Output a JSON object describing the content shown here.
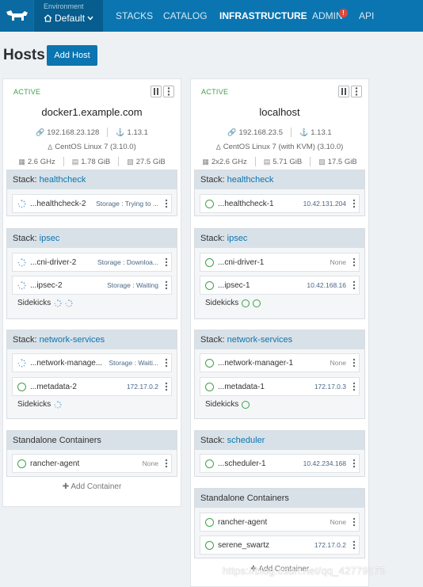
{
  "nav": {
    "environment_caption": "Environment",
    "environment_value": "Default",
    "items": [
      "STACKS",
      "CATALOG",
      "INFRASTRUCTURE",
      "ADMIN",
      "API"
    ],
    "admin_badge": "!"
  },
  "page": {
    "title": "Hosts",
    "add_host": "Add Host"
  },
  "hosts": [
    {
      "state": "ACTIVE",
      "name": "docker1.example.com",
      "ip": "192.168.23.128",
      "docker_version": "1.13.1",
      "os": "CentOS Linux 7 (3.10.0)",
      "cpu": "2.6 GHz",
      "memory": "1.78 GiB",
      "storage": "27.5 GiB",
      "stacks": [
        {
          "label": "Stack:",
          "name": "healthcheck",
          "containers": [
            {
              "name": "...healthcheck-2",
              "ip": "Storage : Trying to ..."
            }
          ]
        },
        {
          "label": "Stack:",
          "name": "ipsec",
          "containers": [
            {
              "name": "...cni-driver-2",
              "ip": "Storage : Downloa..."
            },
            {
              "name": "...ipsec-2",
              "ip": "Storage : Waiting"
            }
          ],
          "sidekicks": "Sidekicks"
        },
        {
          "label": "Stack:",
          "name": "network-services",
          "containers": [
            {
              "name": "...network-manage...",
              "ip": "Storage : Waiti..."
            },
            {
              "name": "...metadata-2",
              "ip": "172.17.0.2"
            }
          ],
          "sidekicks": "Sidekicks"
        },
        {
          "label": "Standalone Containers",
          "name": "",
          "containers": [
            {
              "name": "rancher-agent",
              "ip": "None"
            }
          ]
        }
      ],
      "add_container": "Add Container"
    },
    {
      "state": "ACTIVE",
      "name": "localhost",
      "ip": "192.168.23.5",
      "docker_version": "1.13.1",
      "os": "CentOS Linux 7 (with KVM) (3.10.0)",
      "cpu": "2x2.6 GHz",
      "memory": "5.71 GiB",
      "storage": "17.5 GiB",
      "stacks": [
        {
          "label": "Stack:",
          "name": "healthcheck",
          "containers": [
            {
              "name": "...healthcheck-1",
              "ip": "10.42.131.204"
            }
          ]
        },
        {
          "label": "Stack:",
          "name": "ipsec",
          "containers": [
            {
              "name": "...cni-driver-1",
              "ip": "None"
            },
            {
              "name": "...ipsec-1",
              "ip": "10.42.168.16"
            }
          ],
          "sidekicks": "Sidekicks"
        },
        {
          "label": "Stack:",
          "name": "network-services",
          "containers": [
            {
              "name": "...network-manager-1",
              "ip": "None"
            },
            {
              "name": "...metadata-1",
              "ip": "172.17.0.3"
            }
          ],
          "sidekicks": "Sidekicks"
        },
        {
          "label": "Stack:",
          "name": "scheduler",
          "containers": [
            {
              "name": "...scheduler-1",
              "ip": "10.42.234.168"
            }
          ]
        },
        {
          "label": "Standalone Containers",
          "name": "",
          "containers": [
            {
              "name": "rancher-agent",
              "ip": "None"
            },
            {
              "name": "serene_swartz",
              "ip": "172.17.0.2"
            }
          ]
        }
      ],
      "add_container": "Add Container"
    }
  ],
  "watermark": "https://blog.csdn.net/qq_42779175",
  "colors": {
    "primary": "#0a75b0",
    "active": "#3f9e4a",
    "header": "#d9e1e8"
  }
}
